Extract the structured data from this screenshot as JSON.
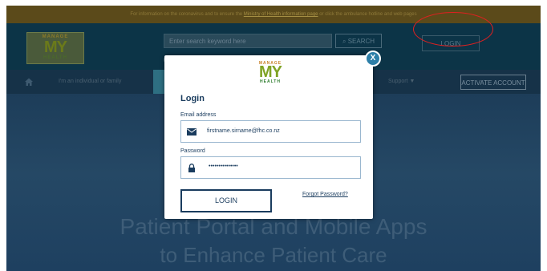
{
  "banner": {
    "text_before": "For information on the coronavirus and to ensure the",
    "link": "Ministry of Health information page",
    "text_after": "or click the ambulance hotline and web pages"
  },
  "header": {
    "logo": {
      "top": "MANAGE",
      "main": "MY",
      "bottom": "HEALTH"
    },
    "search_placeholder": "Enter search keyword here",
    "search_button": "SEARCH",
    "login_button": "LOGIN"
  },
  "nav": {
    "individual": "I'm an individual or family",
    "support": "Support ▼",
    "activate": "ACTIVATE ACCOUNT"
  },
  "hero": {
    "line1": "Patient Portal and Mobile Apps",
    "line2": "to Enhance Patient Care"
  },
  "modal": {
    "logo": {
      "top": "MANAGE",
      "main": "MY",
      "bottom": "HEALTH"
    },
    "close": "X",
    "title": "Login",
    "email_label": "Email address",
    "email_value": "firstname.sirname@fhc.co.nz",
    "password_label": "Password",
    "password_value": "•••••••••••••••",
    "login_button": "LOGIN",
    "forgot_link": "Forgot Password?"
  },
  "colors": {
    "accent": "#1a3c5e",
    "highlight": "#e02020",
    "close_button": "#2d7fa8",
    "logo_green": "#7fa324",
    "logo_orange": "#c9822a"
  }
}
